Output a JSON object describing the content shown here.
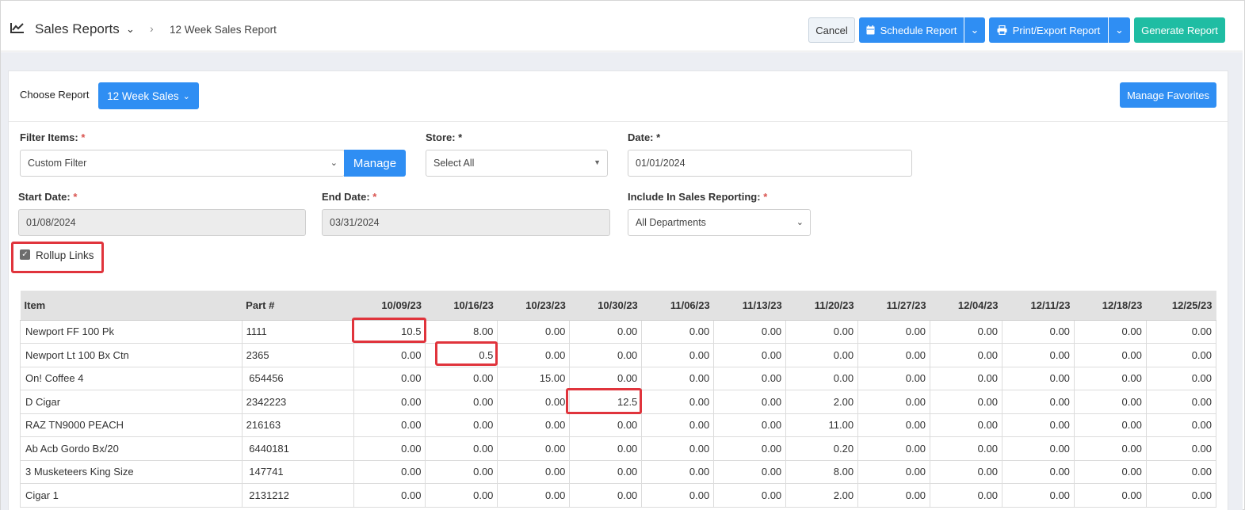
{
  "header": {
    "app_title": "Sales Reports",
    "breadcrumb_current": "12 Week Sales Report",
    "cancel_label": "Cancel",
    "schedule_label": "Schedule Report",
    "print_label": "Print/Export Report",
    "generate_label": "Generate Report"
  },
  "chooser": {
    "label": "Choose Report",
    "selected": "12 Week Sales",
    "manage_favorites": "Manage Favorites"
  },
  "filters": {
    "filter_items_label": "Filter Items:",
    "filter_items_value": "Custom Filter",
    "manage_label": "Manage",
    "store_label": "Store: *",
    "store_value": "Select All",
    "date_label": "Date: *",
    "date_value": "01/01/2024",
    "start_date_label": "Start Date:",
    "start_date_value": "01/08/2024",
    "end_date_label": "End Date:",
    "end_date_value": "03/31/2024",
    "include_label": "Include In Sales Reporting:",
    "include_value": "All Departments",
    "required_mark": "*",
    "rollup_label": "Rollup Links",
    "rollup_checked": true
  },
  "table": {
    "headers": [
      "Item",
      "Part #",
      "10/09/23",
      "10/16/23",
      "10/23/23",
      "10/30/23",
      "11/06/23",
      "11/13/23",
      "11/20/23",
      "11/27/23",
      "12/04/23",
      "12/11/23",
      "12/18/23",
      "12/25/23"
    ],
    "rows": [
      [
        "Newport FF 100 Pk",
        "1111",
        "10.5",
        "8.00",
        "0.00",
        "0.00",
        "0.00",
        "0.00",
        "0.00",
        "0.00",
        "0.00",
        "0.00",
        "0.00",
        "0.00"
      ],
      [
        "Newport Lt 100 Bx Ctn",
        "2365",
        "0.00",
        "0.5",
        "0.00",
        "0.00",
        "0.00",
        "0.00",
        "0.00",
        "0.00",
        "0.00",
        "0.00",
        "0.00",
        "0.00"
      ],
      [
        "On! Coffee 4",
        " 654456",
        "0.00",
        "0.00",
        "15.00",
        "0.00",
        "0.00",
        "0.00",
        "0.00",
        "0.00",
        "0.00",
        "0.00",
        "0.00",
        "0.00"
      ],
      [
        "D Cigar",
        "2342223",
        "0.00",
        "0.00",
        "0.00",
        "12.5",
        "0.00",
        "0.00",
        "2.00",
        "0.00",
        "0.00",
        "0.00",
        "0.00",
        "0.00"
      ],
      [
        "RAZ TN9000 PEACH",
        "216163",
        "0.00",
        "0.00",
        "0.00",
        "0.00",
        "0.00",
        "0.00",
        "11.00",
        "0.00",
        "0.00",
        "0.00",
        "0.00",
        "0.00"
      ],
      [
        "Ab Acb Gordo Bx/20",
        " 6440181",
        "0.00",
        "0.00",
        "0.00",
        "0.00",
        "0.00",
        "0.00",
        "0.20",
        "0.00",
        "0.00",
        "0.00",
        "0.00",
        "0.00"
      ],
      [
        "3 Musketeers King Size",
        " 147741",
        "0.00",
        "0.00",
        "0.00",
        "0.00",
        "0.00",
        "0.00",
        "8.00",
        "0.00",
        "0.00",
        "0.00",
        "0.00",
        "0.00"
      ],
      [
        "Cigar 1",
        " 2131212",
        "0.00",
        "0.00",
        "0.00",
        "0.00",
        "0.00",
        "0.00",
        "2.00",
        "0.00",
        "0.00",
        "0.00",
        "0.00",
        "0.00"
      ]
    ]
  },
  "colors": {
    "primary": "#2f8ef3",
    "generate": "#1fbda3",
    "highlight": "#e0343c",
    "required": "#d9534f"
  }
}
